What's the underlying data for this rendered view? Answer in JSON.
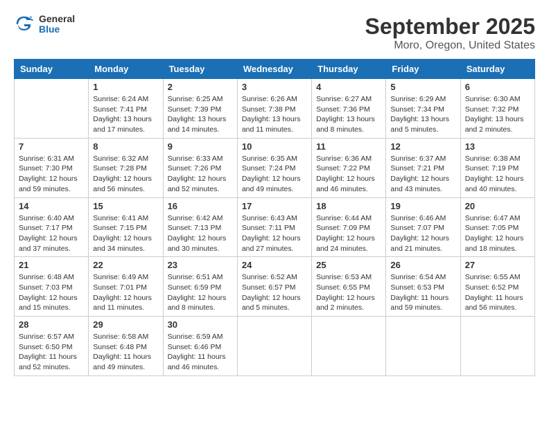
{
  "header": {
    "logo_general": "General",
    "logo_blue": "Blue",
    "title": "September 2025",
    "subtitle": "Moro, Oregon, United States"
  },
  "days_of_week": [
    "Sunday",
    "Monday",
    "Tuesday",
    "Wednesday",
    "Thursday",
    "Friday",
    "Saturday"
  ],
  "weeks": [
    [
      {
        "day": "",
        "content": ""
      },
      {
        "day": "1",
        "content": "Sunrise: 6:24 AM\nSunset: 7:41 PM\nDaylight: 13 hours\nand 17 minutes."
      },
      {
        "day": "2",
        "content": "Sunrise: 6:25 AM\nSunset: 7:39 PM\nDaylight: 13 hours\nand 14 minutes."
      },
      {
        "day": "3",
        "content": "Sunrise: 6:26 AM\nSunset: 7:38 PM\nDaylight: 13 hours\nand 11 minutes."
      },
      {
        "day": "4",
        "content": "Sunrise: 6:27 AM\nSunset: 7:36 PM\nDaylight: 13 hours\nand 8 minutes."
      },
      {
        "day": "5",
        "content": "Sunrise: 6:29 AM\nSunset: 7:34 PM\nDaylight: 13 hours\nand 5 minutes."
      },
      {
        "day": "6",
        "content": "Sunrise: 6:30 AM\nSunset: 7:32 PM\nDaylight: 13 hours\nand 2 minutes."
      }
    ],
    [
      {
        "day": "7",
        "content": "Sunrise: 6:31 AM\nSunset: 7:30 PM\nDaylight: 12 hours\nand 59 minutes."
      },
      {
        "day": "8",
        "content": "Sunrise: 6:32 AM\nSunset: 7:28 PM\nDaylight: 12 hours\nand 56 minutes."
      },
      {
        "day": "9",
        "content": "Sunrise: 6:33 AM\nSunset: 7:26 PM\nDaylight: 12 hours\nand 52 minutes."
      },
      {
        "day": "10",
        "content": "Sunrise: 6:35 AM\nSunset: 7:24 PM\nDaylight: 12 hours\nand 49 minutes."
      },
      {
        "day": "11",
        "content": "Sunrise: 6:36 AM\nSunset: 7:22 PM\nDaylight: 12 hours\nand 46 minutes."
      },
      {
        "day": "12",
        "content": "Sunrise: 6:37 AM\nSunset: 7:21 PM\nDaylight: 12 hours\nand 43 minutes."
      },
      {
        "day": "13",
        "content": "Sunrise: 6:38 AM\nSunset: 7:19 PM\nDaylight: 12 hours\nand 40 minutes."
      }
    ],
    [
      {
        "day": "14",
        "content": "Sunrise: 6:40 AM\nSunset: 7:17 PM\nDaylight: 12 hours\nand 37 minutes."
      },
      {
        "day": "15",
        "content": "Sunrise: 6:41 AM\nSunset: 7:15 PM\nDaylight: 12 hours\nand 34 minutes."
      },
      {
        "day": "16",
        "content": "Sunrise: 6:42 AM\nSunset: 7:13 PM\nDaylight: 12 hours\nand 30 minutes."
      },
      {
        "day": "17",
        "content": "Sunrise: 6:43 AM\nSunset: 7:11 PM\nDaylight: 12 hours\nand 27 minutes."
      },
      {
        "day": "18",
        "content": "Sunrise: 6:44 AM\nSunset: 7:09 PM\nDaylight: 12 hours\nand 24 minutes."
      },
      {
        "day": "19",
        "content": "Sunrise: 6:46 AM\nSunset: 7:07 PM\nDaylight: 12 hours\nand 21 minutes."
      },
      {
        "day": "20",
        "content": "Sunrise: 6:47 AM\nSunset: 7:05 PM\nDaylight: 12 hours\nand 18 minutes."
      }
    ],
    [
      {
        "day": "21",
        "content": "Sunrise: 6:48 AM\nSunset: 7:03 PM\nDaylight: 12 hours\nand 15 minutes."
      },
      {
        "day": "22",
        "content": "Sunrise: 6:49 AM\nSunset: 7:01 PM\nDaylight: 12 hours\nand 11 minutes."
      },
      {
        "day": "23",
        "content": "Sunrise: 6:51 AM\nSunset: 6:59 PM\nDaylight: 12 hours\nand 8 minutes."
      },
      {
        "day": "24",
        "content": "Sunrise: 6:52 AM\nSunset: 6:57 PM\nDaylight: 12 hours\nand 5 minutes."
      },
      {
        "day": "25",
        "content": "Sunrise: 6:53 AM\nSunset: 6:55 PM\nDaylight: 12 hours\nand 2 minutes."
      },
      {
        "day": "26",
        "content": "Sunrise: 6:54 AM\nSunset: 6:53 PM\nDaylight: 11 hours\nand 59 minutes."
      },
      {
        "day": "27",
        "content": "Sunrise: 6:55 AM\nSunset: 6:52 PM\nDaylight: 11 hours\nand 56 minutes."
      }
    ],
    [
      {
        "day": "28",
        "content": "Sunrise: 6:57 AM\nSunset: 6:50 PM\nDaylight: 11 hours\nand 52 minutes."
      },
      {
        "day": "29",
        "content": "Sunrise: 6:58 AM\nSunset: 6:48 PM\nDaylight: 11 hours\nand 49 minutes."
      },
      {
        "day": "30",
        "content": "Sunrise: 6:59 AM\nSunset: 6:46 PM\nDaylight: 11 hours\nand 46 minutes."
      },
      {
        "day": "",
        "content": ""
      },
      {
        "day": "",
        "content": ""
      },
      {
        "day": "",
        "content": ""
      },
      {
        "day": "",
        "content": ""
      }
    ]
  ]
}
